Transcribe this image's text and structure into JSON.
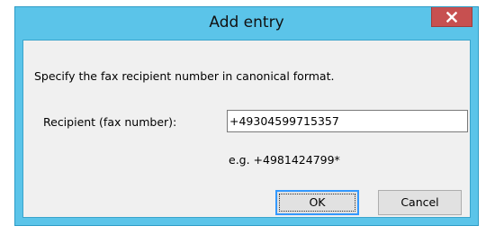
{
  "window": {
    "title": "Add entry",
    "close_icon": "close-x-icon"
  },
  "dialog": {
    "instruction": "Specify the fax recipient number in canonical format.",
    "recipient_label": "Recipient (fax number):",
    "recipient_value": "+49304599715357",
    "example_text": "e.g. +4981424799*",
    "ok_label": "OK",
    "cancel_label": "Cancel"
  },
  "colors": {
    "frame": "#5bc4e9",
    "close_button": "#c75050",
    "client_background": "#f0f0f0",
    "focus_border": "#3399ff"
  }
}
